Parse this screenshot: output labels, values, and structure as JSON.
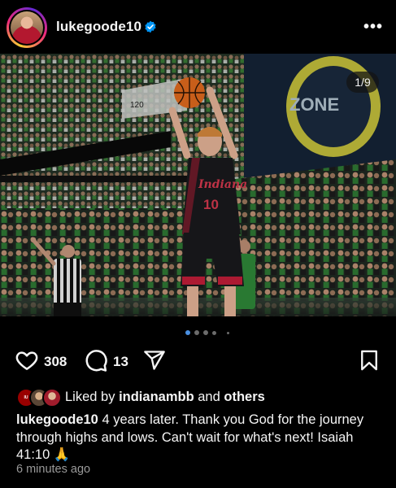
{
  "header": {
    "username": "lukegoode10",
    "verified_icon": "verified-badge-icon",
    "more_icon": "more-options-icon",
    "more_label": "•••"
  },
  "post": {
    "counter": "1/9",
    "scoreboard_text": "120",
    "arena_sign_text": "ZONE",
    "jersey_name": "Indiana",
    "jersey_number": "10",
    "carousel": {
      "total_dots": 5,
      "active_index": 0
    }
  },
  "actions": {
    "like_icon": "heart-icon",
    "likes": "308",
    "comment_icon": "comment-icon",
    "comments": "13",
    "share_icon": "send-icon",
    "save_icon": "bookmark-icon"
  },
  "liked_by": {
    "prefix": "Liked by",
    "user": "indianambb",
    "and": "and",
    "others": "others"
  },
  "caption": {
    "username": "lukegoode10",
    "text": "4 years later. Thank you God for the journey through highs and lows. Can't wait for what's next! Isaiah 41:10 🙏"
  },
  "timestamp": "6 minutes ago",
  "colors": {
    "background": "#000000",
    "verified": "#0095f6",
    "indiana_crimson": "#990000",
    "active_dot": "#4a90e2"
  }
}
